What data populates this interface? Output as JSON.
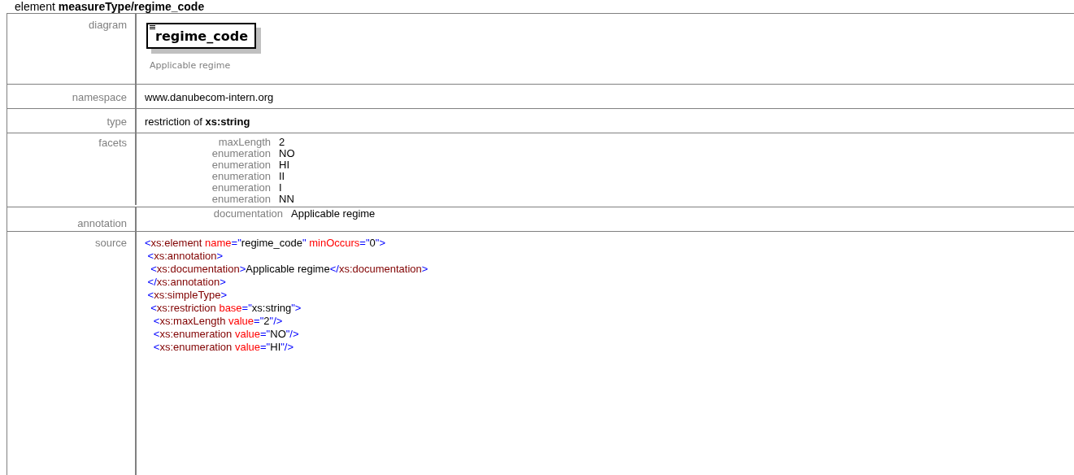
{
  "heading": {
    "prefix": "element",
    "path": "measureType/regime_code"
  },
  "diagram": {
    "label": "diagram",
    "element_name": "regime_code",
    "caption": "Applicable regime"
  },
  "namespace": {
    "label": "namespace",
    "value": "www.danubecom-intern.org"
  },
  "type": {
    "label": "type",
    "value": "restriction of **xs:string**"
  },
  "facets": {
    "label": "facets",
    "items": [
      {
        "name": "maxLength",
        "value": "2"
      },
      {
        "name": "enumeration",
        "value": "NO"
      },
      {
        "name": "enumeration",
        "value": "HI"
      },
      {
        "name": "enumeration",
        "value": "II"
      },
      {
        "name": "enumeration",
        "value": "I"
      },
      {
        "name": "enumeration",
        "value": "NN"
      }
    ]
  },
  "annotation": {
    "label": "annotation",
    "items": [
      {
        "name": "documentation",
        "value": "Applicable regime"
      }
    ]
  },
  "source": {
    "label": "source",
    "lines": [
      [
        {
          "kind": "punct",
          "text": "<"
        },
        {
          "kind": "tag",
          "text": "xs:element"
        },
        {
          "kind": "attr",
          "text": " name"
        },
        {
          "kind": "punct",
          "text": "=\""
        },
        {
          "kind": "text",
          "text": "regime_code"
        },
        {
          "kind": "punct",
          "text": "\""
        },
        {
          "kind": "attr",
          "text": " minOccurs"
        },
        {
          "kind": "punct",
          "text": "=\""
        },
        {
          "kind": "text",
          "text": "0"
        },
        {
          "kind": "punct",
          "text": "\">"
        }
      ],
      [
        {
          "kind": "punct",
          "text": " <"
        },
        {
          "kind": "tag",
          "text": "xs:annotation"
        },
        {
          "kind": "punct",
          "text": ">"
        }
      ],
      [
        {
          "kind": "punct",
          "text": "  <"
        },
        {
          "kind": "tag",
          "text": "xs:documentation"
        },
        {
          "kind": "punct",
          "text": ">"
        },
        {
          "kind": "text",
          "text": "Applicable regime"
        },
        {
          "kind": "punct",
          "text": "</"
        },
        {
          "kind": "tag",
          "text": "xs:documentation"
        },
        {
          "kind": "punct",
          "text": ">"
        }
      ],
      [
        {
          "kind": "punct",
          "text": " </"
        },
        {
          "kind": "tag",
          "text": "xs:annotation"
        },
        {
          "kind": "punct",
          "text": ">"
        }
      ],
      [
        {
          "kind": "punct",
          "text": " <"
        },
        {
          "kind": "tag",
          "text": "xs:simpleType"
        },
        {
          "kind": "punct",
          "text": ">"
        }
      ],
      [
        {
          "kind": "punct",
          "text": "  <"
        },
        {
          "kind": "tag",
          "text": "xs:restriction"
        },
        {
          "kind": "attr",
          "text": " base"
        },
        {
          "kind": "punct",
          "text": "=\""
        },
        {
          "kind": "text",
          "text": "xs:string"
        },
        {
          "kind": "punct",
          "text": "\">"
        }
      ],
      [
        {
          "kind": "punct",
          "text": "   <"
        },
        {
          "kind": "tag",
          "text": "xs:maxLength"
        },
        {
          "kind": "attr",
          "text": " value"
        },
        {
          "kind": "punct",
          "text": "=\""
        },
        {
          "kind": "text",
          "text": "2"
        },
        {
          "kind": "punct",
          "text": "\"/>"
        }
      ],
      [
        {
          "kind": "punct",
          "text": "   <"
        },
        {
          "kind": "tag",
          "text": "xs:enumeration"
        },
        {
          "kind": "attr",
          "text": " value"
        },
        {
          "kind": "punct",
          "text": "=\""
        },
        {
          "kind": "text",
          "text": "NO"
        },
        {
          "kind": "punct",
          "text": "\"/>"
        }
      ],
      [
        {
          "kind": "punct",
          "text": "   <"
        },
        {
          "kind": "tag",
          "text": "xs:enumeration"
        },
        {
          "kind": "attr",
          "text": " value"
        },
        {
          "kind": "punct",
          "text": "=\""
        },
        {
          "kind": "text",
          "text": "HI"
        },
        {
          "kind": "punct",
          "text": "\"/>"
        }
      ]
    ]
  }
}
